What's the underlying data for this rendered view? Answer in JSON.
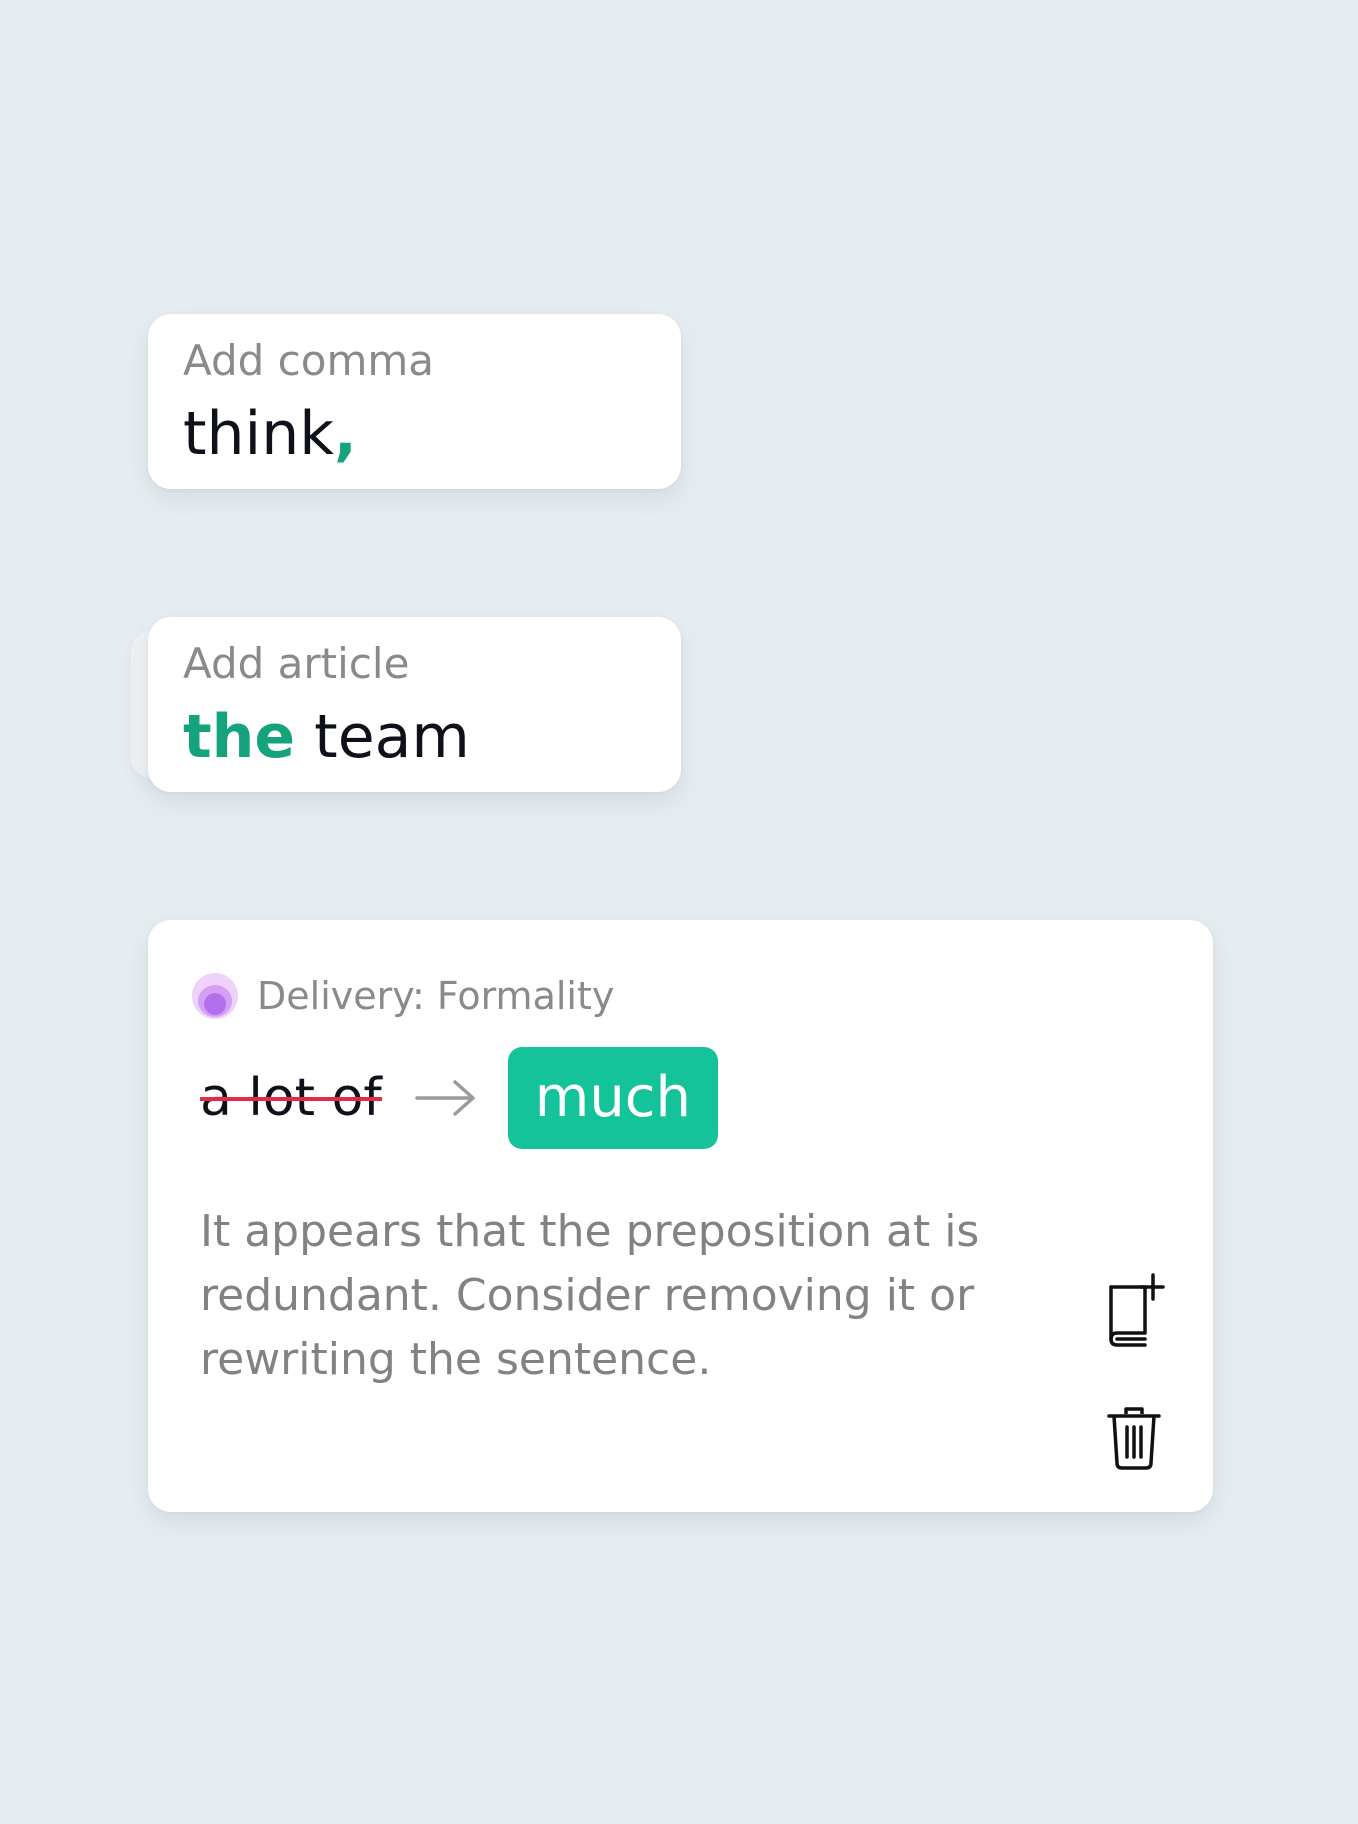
{
  "cards": {
    "comma": {
      "label": "Add comma",
      "word": "think",
      "insertion": ","
    },
    "article": {
      "label": "Add article",
      "insertion": "the",
      "word": " team"
    },
    "delivery": {
      "category": "Delivery: Formality",
      "category_icon": "tone-dot-icon",
      "removed_text": "a lot of",
      "suggestion": "much",
      "description": "It appears that the preposition at is redundant. Consider removing it or rewriting the sentence.",
      "actions": [
        {
          "name": "add-to-dictionary",
          "icon": "book-plus-icon"
        },
        {
          "name": "delete",
          "icon": "trash-icon"
        }
      ]
    }
  },
  "colors": {
    "background": "#e6edf0",
    "accent_green": "#15c39a",
    "insert_green": "#15a37e",
    "strike_red": "#e32a4b",
    "tone_purple": "#b270ef"
  }
}
